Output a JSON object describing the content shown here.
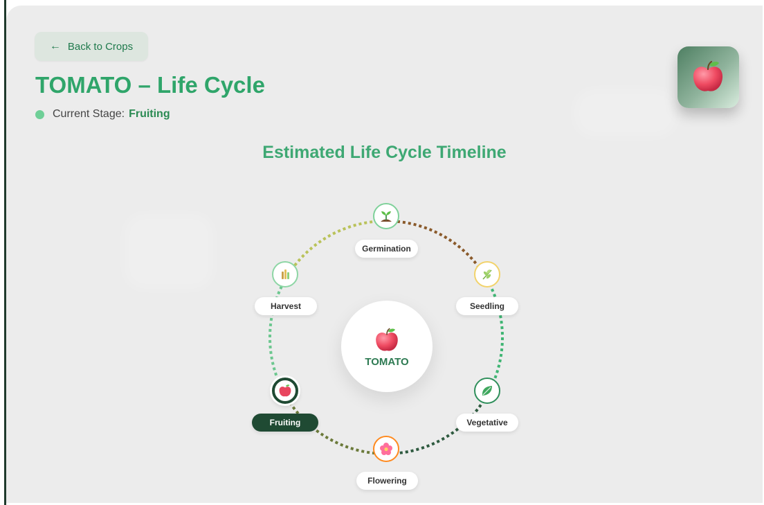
{
  "header": {
    "back_button_label": "Back to Crops",
    "back_icon": "arrow-left-icon",
    "title": "TOMATO – Life Cycle",
    "current_stage_prefix": "Current Stage:",
    "current_stage_value": "Fruiting",
    "crop_tile_icon": "apple-icon"
  },
  "timeline": {
    "title": "Estimated Life Cycle Timeline",
    "center_label": "TOMATO",
    "center_icon": "apple-icon",
    "current_stage": "Fruiting",
    "stages": [
      {
        "label": "Germination",
        "icon": "sprout-icon",
        "color": "#7fd19a"
      },
      {
        "label": "Seedling",
        "icon": "seedling-icon",
        "color": "#f2d36b"
      },
      {
        "label": "Vegetative",
        "icon": "leaf-icon",
        "color": "#2f8f5b"
      },
      {
        "label": "Flowering",
        "icon": "flower-icon",
        "color": "#ff8a1f"
      },
      {
        "label": "Fruiting",
        "icon": "fruit-icon",
        "color": "#1f4a33"
      },
      {
        "label": "Harvest",
        "icon": "wheat-icon",
        "color": "#8ed6a5"
      }
    ]
  },
  "colors": {
    "accent_green": "#2fa56a",
    "dark_green": "#1f4a33",
    "panel_bg": "#ececec",
    "stage_dot": "#6fcf97"
  }
}
